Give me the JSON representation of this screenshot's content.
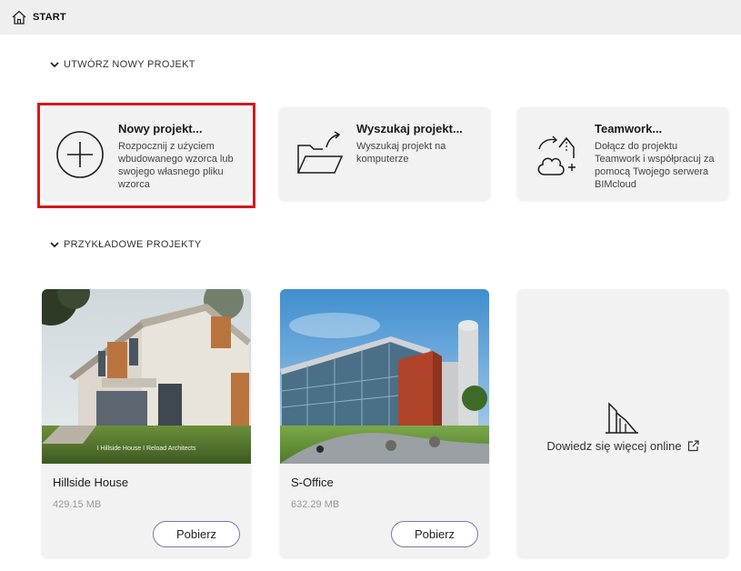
{
  "header": {
    "title": "START",
    "icon": "home-icon"
  },
  "sections": {
    "new_project": {
      "label": "UTWÓRZ NOWY PROJEKT"
    },
    "samples": {
      "label": "PRZYKŁADOWE PROJEKTY"
    }
  },
  "actions": [
    {
      "title": "Nowy projekt...",
      "desc": "Rozpocznij z użyciem wbudowanego wzorca lub swojego własnego pliku wzorca",
      "icon": "plus-circle-icon"
    },
    {
      "title": "Wyszukaj projekt...",
      "desc": "Wyszukaj projekt na komputerze",
      "icon": "open-folder-icon"
    },
    {
      "title": "Teamwork...",
      "desc": "Dołącz do projektu Teamwork i współpracuj za pomocą Twojego serwera BIMcloud",
      "icon": "teamwork-cloud-icon"
    }
  ],
  "samples": [
    {
      "name": "Hillside House",
      "size": "429.15 MB",
      "button": "Pobierz",
      "caption": "I Hillside House I Reload Architects"
    },
    {
      "name": "S-Office",
      "size": "632.29 MB",
      "button": "Pobierz"
    }
  ],
  "learn_more": {
    "label": "Dowiedz się więcej online",
    "icon": "external-link-icon"
  },
  "colors": {
    "highlight": "#d4191c",
    "card_bg": "#f2f2f2",
    "topbar_bg": "#efefef",
    "button_border": "#7a7aa6"
  }
}
